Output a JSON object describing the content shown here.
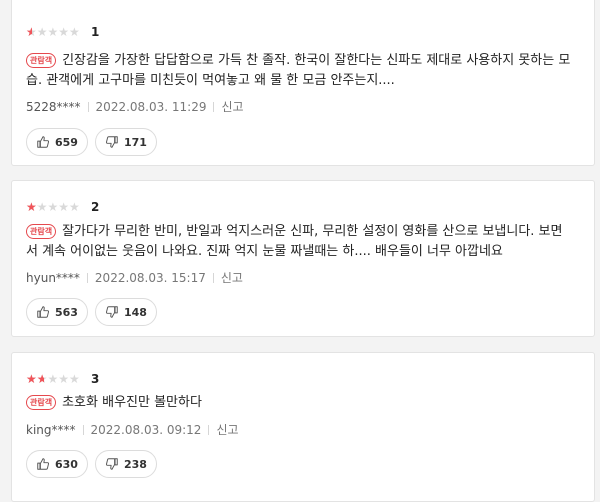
{
  "reviews": [
    {
      "score": "1",
      "rating_fraction": 0.1,
      "badge": "관람객",
      "text": "긴장감을 가장한 답답함으로 가득 찬 졸작. 한국이 잘한다는 신파도 제대로 사용하지 못하는 모습. 관객에게 고구마를 미친듯이 먹여놓고 왜 물 한 모금 안주는지....",
      "user": "5228****",
      "date": "2022.08.03. 11:29",
      "report": "신고",
      "likes": "659",
      "dislikes": "171"
    },
    {
      "score": "2",
      "rating_fraction": 0.2,
      "badge": "관람객",
      "text": "잘가다가 무리한 반미, 반일과 억지스러운 신파, 무리한 설정이 영화를 산으로 보냅니다. 보면서 계속 어이없는 웃음이 나와요. 진짜 억지 눈물 짜낼때는 하.... 배우들이 너무 아깝네요",
      "user": "hyun****",
      "date": "2022.08.03. 15:17",
      "report": "신고",
      "likes": "563",
      "dislikes": "148"
    },
    {
      "score": "3",
      "rating_fraction": 0.3,
      "badge": "관람객",
      "text": "초호화 배우진만 볼만하다",
      "user": "king****",
      "date": "2022.08.03. 09:12",
      "report": "신고",
      "likes": "630",
      "dislikes": "238"
    }
  ],
  "icons": {
    "star": "star-icon",
    "like": "thumbs-up-icon",
    "dislike": "thumbs-down-icon"
  },
  "colors": {
    "star_filled": "#f0545a",
    "star_empty": "#d9d9d9",
    "badge": "#e5484d"
  }
}
